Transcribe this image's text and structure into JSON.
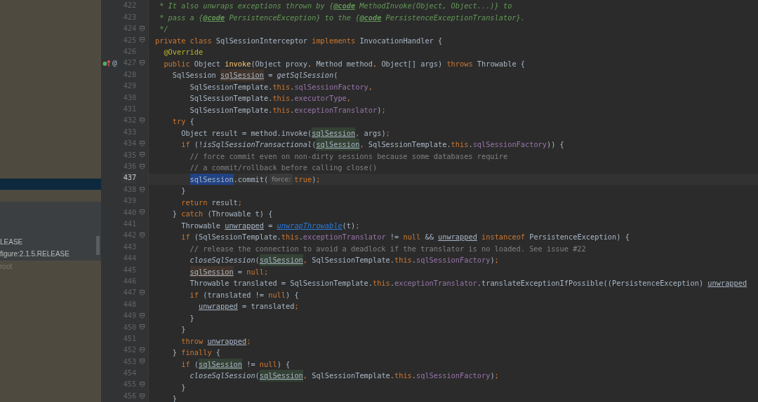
{
  "sidebar": {
    "rows": [
      {
        "selected": true
      }
    ],
    "popup_lines": [
      "LEASE",
      "figure:2.1.5.RELEASE"
    ],
    "dimmed_item": {
      "text": "root",
      "disabled": true
    }
  },
  "editor": {
    "lines": [
      {
        "number": "422",
        "fold": false,
        "current": false,
        "tokens": [
          {
            "kind": "doc",
            "text": " * It also unwraps exceptions thrown by {"
          },
          {
            "kind": "doc-tag",
            "text": "@code"
          },
          {
            "kind": "doc",
            "text": " MethodInvoke(Object, Object...)} to"
          }
        ]
      },
      {
        "number": "423",
        "fold": false,
        "current": false,
        "tokens": [
          {
            "kind": "doc",
            "text": " * pass a {"
          },
          {
            "kind": "doc-tag",
            "text": "@code"
          },
          {
            "kind": "doc",
            "text": " PersistenceException} to the {"
          },
          {
            "kind": "doc-tag",
            "text": "@code"
          },
          {
            "kind": "doc",
            "text": " PersistenceExceptionTranslator}."
          }
        ]
      },
      {
        "number": "424",
        "fold": true,
        "current": false,
        "tokens": [
          {
            "kind": "doc",
            "text": " */"
          }
        ]
      },
      {
        "number": "425",
        "fold": true,
        "current": false,
        "tokens": [
          {
            "kind": "keyword",
            "text": "private class "
          },
          {
            "kind": "plain",
            "text": "SqlSessionInterceptor "
          },
          {
            "kind": "keyword",
            "text": "implements "
          },
          {
            "kind": "plain",
            "text": "InvocationHandler {"
          }
        ],
        "children": [
          {
            "number": "426",
            "fold": false,
            "current": false,
            "tokens": [
              {
                "kind": "annotation",
                "text": "@Override"
              }
            ]
          },
          {
            "number": "427",
            "fold": true,
            "current": false,
            "gutter": [
              {
                "kind": "override-icon"
              },
              {
                "kind": "char",
                "text": "@"
              }
            ],
            "tokens": [
              {
                "kind": "keyword",
                "text": "public "
              },
              {
                "kind": "plain",
                "text": "Object "
              },
              {
                "kind": "method-decl",
                "text": "invoke"
              },
              {
                "kind": "plain",
                "text": "(Object proxy"
              },
              {
                "kind": "punct",
                "text": ", "
              },
              {
                "kind": "plain",
                "text": "Method method"
              },
              {
                "kind": "punct",
                "text": ", "
              },
              {
                "kind": "plain",
                "text": "Object[] args) "
              },
              {
                "kind": "keyword",
                "text": "throws "
              },
              {
                "kind": "plain",
                "text": "Throwable {"
              }
            ],
            "children": [
              {
                "number": "428",
                "fold": false,
                "current": false,
                "tokens": [
                  {
                    "kind": "plain",
                    "text": "SqlSession "
                  },
                  {
                    "kind": "write",
                    "text": "sqlSession"
                  },
                  {
                    "kind": "plain",
                    "text": " = "
                  },
                  {
                    "kind": "static",
                    "text": "getSqlSession"
                  },
                  {
                    "kind": "plain",
                    "text": "("
                  }
                ],
                "children": [
                  {
                    "number": "429",
                    "fold": false,
                    "current": false,
                    "continuation": true,
                    "tokens": [
                      {
                        "kind": "plain",
                        "text": "SqlSessionTemplate."
                      },
                      {
                        "kind": "keyword",
                        "text": "this"
                      },
                      {
                        "kind": "plain",
                        "text": "."
                      },
                      {
                        "kind": "field",
                        "text": "sqlSessionFactory"
                      },
                      {
                        "kind": "punct",
                        "text": ","
                      }
                    ]
                  },
                  {
                    "number": "430",
                    "fold": false,
                    "current": false,
                    "continuation": true,
                    "tokens": [
                      {
                        "kind": "plain",
                        "text": "SqlSessionTemplate."
                      },
                      {
                        "kind": "keyword",
                        "text": "this"
                      },
                      {
                        "kind": "plain",
                        "text": "."
                      },
                      {
                        "kind": "field",
                        "text": "executorType"
                      },
                      {
                        "kind": "punct",
                        "text": ","
                      }
                    ]
                  },
                  {
                    "number": "431",
                    "fold": false,
                    "current": false,
                    "continuation": true,
                    "tokens": [
                      {
                        "kind": "plain",
                        "text": "SqlSessionTemplate."
                      },
                      {
                        "kind": "keyword",
                        "text": "this"
                      },
                      {
                        "kind": "plain",
                        "text": "."
                      },
                      {
                        "kind": "field",
                        "text": "exceptionTranslator"
                      },
                      {
                        "kind": "plain",
                        "text": ")"
                      },
                      {
                        "kind": "punct",
                        "text": ";"
                      }
                    ]
                  }
                ]
              },
              {
                "number": "432",
                "fold": true,
                "current": false,
                "tokens": [
                  {
                    "kind": "keyword",
                    "text": "try "
                  },
                  {
                    "kind": "plain",
                    "text": "{"
                  }
                ],
                "children": [
                  {
                    "number": "433",
                    "fold": false,
                    "current": false,
                    "tokens": [
                      {
                        "kind": "plain",
                        "text": "Object result = method.invoke("
                      },
                      {
                        "kind": "read",
                        "text": "sqlSession"
                      },
                      {
                        "kind": "punct",
                        "text": ", "
                      },
                      {
                        "kind": "plain",
                        "text": "args)"
                      },
                      {
                        "kind": "punct",
                        "text": ";"
                      }
                    ]
                  },
                  {
                    "number": "434",
                    "fold": true,
                    "current": false,
                    "tokens": [
                      {
                        "kind": "keyword",
                        "text": "if "
                      },
                      {
                        "kind": "plain",
                        "text": "(!"
                      },
                      {
                        "kind": "static",
                        "text": "isSqlSessionTransactional"
                      },
                      {
                        "kind": "plain",
                        "text": "("
                      },
                      {
                        "kind": "read",
                        "text": "sqlSession"
                      },
                      {
                        "kind": "punct",
                        "text": ", "
                      },
                      {
                        "kind": "plain",
                        "text": "SqlSessionTemplate."
                      },
                      {
                        "kind": "keyword",
                        "text": "this"
                      },
                      {
                        "kind": "plain",
                        "text": "."
                      },
                      {
                        "kind": "field",
                        "text": "sqlSessionFactory"
                      },
                      {
                        "kind": "plain",
                        "text": ")) {"
                      }
                    ],
                    "children": [
                      {
                        "number": "435",
                        "fold": true,
                        "current": false,
                        "tokens": [
                          {
                            "kind": "comment",
                            "text": "// force commit even on non-dirty sessions because some databases require"
                          }
                        ]
                      },
                      {
                        "number": "436",
                        "fold": true,
                        "current": false,
                        "tokens": [
                          {
                            "kind": "comment",
                            "text": "// a commit/rollback before calling close()"
                          }
                        ]
                      },
                      {
                        "number": "437",
                        "fold": false,
                        "current": true,
                        "tokens": [
                          {
                            "kind": "selected",
                            "text": "sqlSession"
                          },
                          {
                            "kind": "plain",
                            "text": ".commit("
                          },
                          {
                            "kind": "hint",
                            "text": "force:"
                          },
                          {
                            "kind": "keyword",
                            "text": "true"
                          },
                          {
                            "kind": "plain",
                            "text": ")"
                          },
                          {
                            "kind": "punct",
                            "text": ";"
                          }
                        ]
                      }
                    ]
                  },
                  {
                    "number": "438",
                    "fold": true,
                    "current": false,
                    "tokens": [
                      {
                        "kind": "plain",
                        "text": "}"
                      }
                    ]
                  },
                  {
                    "number": "439",
                    "fold": false,
                    "current": false,
                    "tokens": [
                      {
                        "kind": "keyword",
                        "text": "return "
                      },
                      {
                        "kind": "plain",
                        "text": "result"
                      },
                      {
                        "kind": "punct",
                        "text": ";"
                      }
                    ]
                  }
                ]
              },
              {
                "number": "440",
                "fold": true,
                "current": false,
                "tokens": [
                  {
                    "kind": "plain",
                    "text": "} "
                  },
                  {
                    "kind": "keyword",
                    "text": "catch "
                  },
                  {
                    "kind": "plain",
                    "text": "(Throwable t) {"
                  }
                ],
                "children": [
                  {
                    "number": "441",
                    "fold": false,
                    "current": false,
                    "tokens": [
                      {
                        "kind": "plain",
                        "text": "Throwable "
                      },
                      {
                        "kind": "var",
                        "text": "unwrapped"
                      },
                      {
                        "kind": "plain",
                        "text": " = "
                      },
                      {
                        "kind": "link",
                        "text": "unwrapThrowable"
                      },
                      {
                        "kind": "plain",
                        "text": "(t)"
                      },
                      {
                        "kind": "punct",
                        "text": ";"
                      }
                    ]
                  },
                  {
                    "number": "442",
                    "fold": true,
                    "current": false,
                    "tokens": [
                      {
                        "kind": "keyword",
                        "text": "if "
                      },
                      {
                        "kind": "plain",
                        "text": "(SqlSessionTemplate."
                      },
                      {
                        "kind": "keyword",
                        "text": "this"
                      },
                      {
                        "kind": "plain",
                        "text": "."
                      },
                      {
                        "kind": "field",
                        "text": "exceptionTranslator"
                      },
                      {
                        "kind": "plain",
                        "text": " != "
                      },
                      {
                        "kind": "keyword",
                        "text": "null "
                      },
                      {
                        "kind": "plain",
                        "text": "&& "
                      },
                      {
                        "kind": "var",
                        "text": "unwrapped"
                      },
                      {
                        "kind": "keyword",
                        "text": " instanceof "
                      },
                      {
                        "kind": "plain",
                        "text": "PersistenceException) {"
                      }
                    ],
                    "children": [
                      {
                        "number": "443",
                        "fold": false,
                        "current": false,
                        "tokens": [
                          {
                            "kind": "comment",
                            "text": "// release the connection to avoid a deadlock if the translator is no loaded. See issue #22"
                          }
                        ]
                      },
                      {
                        "number": "444",
                        "fold": false,
                        "current": false,
                        "tokens": [
                          {
                            "kind": "static",
                            "text": "closeSqlSession"
                          },
                          {
                            "kind": "plain",
                            "text": "("
                          },
                          {
                            "kind": "read",
                            "text": "sqlSession"
                          },
                          {
                            "kind": "punct",
                            "text": ", "
                          },
                          {
                            "kind": "plain",
                            "text": "SqlSessionTemplate."
                          },
                          {
                            "kind": "keyword",
                            "text": "this"
                          },
                          {
                            "kind": "plain",
                            "text": "."
                          },
                          {
                            "kind": "field",
                            "text": "sqlSessionFactory"
                          },
                          {
                            "kind": "plain",
                            "text": ")"
                          },
                          {
                            "kind": "punct",
                            "text": ";"
                          }
                        ]
                      },
                      {
                        "number": "445",
                        "fold": false,
                        "current": false,
                        "tokens": [
                          {
                            "kind": "write",
                            "text": "sqlSession"
                          },
                          {
                            "kind": "plain",
                            "text": " = "
                          },
                          {
                            "kind": "keyword",
                            "text": "null"
                          },
                          {
                            "kind": "punct",
                            "text": ";"
                          }
                        ]
                      },
                      {
                        "number": "446",
                        "fold": false,
                        "current": false,
                        "tokens": [
                          {
                            "kind": "plain",
                            "text": "Throwable translated = SqlSessionTemplate."
                          },
                          {
                            "kind": "keyword",
                            "text": "this"
                          },
                          {
                            "kind": "plain",
                            "text": "."
                          },
                          {
                            "kind": "field",
                            "text": "exceptionTranslator"
                          },
                          {
                            "kind": "plain",
                            "text": ".translateExceptionIfPossible((PersistenceException) "
                          },
                          {
                            "kind": "var",
                            "text": "unwrapped"
                          }
                        ]
                      },
                      {
                        "number": "447",
                        "fold": true,
                        "current": false,
                        "tokens": [
                          {
                            "kind": "keyword",
                            "text": "if "
                          },
                          {
                            "kind": "plain",
                            "text": "(translated != "
                          },
                          {
                            "kind": "keyword",
                            "text": "null"
                          },
                          {
                            "kind": "plain",
                            "text": ") {"
                          }
                        ],
                        "children": [
                          {
                            "number": "448",
                            "fold": false,
                            "current": false,
                            "tokens": [
                              {
                                "kind": "var",
                                "text": "unwrapped"
                              },
                              {
                                "kind": "plain",
                                "text": " = translated"
                              },
                              {
                                "kind": "punct",
                                "text": ";"
                              }
                            ]
                          }
                        ]
                      },
                      {
                        "number": "449",
                        "fold": true,
                        "current": false,
                        "tokens": [
                          {
                            "kind": "plain",
                            "text": "}"
                          }
                        ]
                      }
                    ]
                  },
                  {
                    "number": "450",
                    "fold": true,
                    "current": false,
                    "tokens": [
                      {
                        "kind": "plain",
                        "text": "}"
                      }
                    ]
                  },
                  {
                    "number": "451",
                    "fold": false,
                    "current": false,
                    "tokens": [
                      {
                        "kind": "keyword",
                        "text": "throw "
                      },
                      {
                        "kind": "var",
                        "text": "unwrapped"
                      },
                      {
                        "kind": "punct",
                        "text": ";"
                      }
                    ]
                  }
                ]
              },
              {
                "number": "452",
                "fold": true,
                "current": false,
                "tokens": [
                  {
                    "kind": "plain",
                    "text": "} "
                  },
                  {
                    "kind": "keyword",
                    "text": "finally "
                  },
                  {
                    "kind": "plain",
                    "text": "{"
                  }
                ],
                "children": [
                  {
                    "number": "453",
                    "fold": true,
                    "current": false,
                    "tokens": [
                      {
                        "kind": "keyword",
                        "text": "if "
                      },
                      {
                        "kind": "plain",
                        "text": "("
                      },
                      {
                        "kind": "read",
                        "text": "sqlSession"
                      },
                      {
                        "kind": "plain",
                        "text": " != "
                      },
                      {
                        "kind": "keyword",
                        "text": "null"
                      },
                      {
                        "kind": "plain",
                        "text": ") {"
                      }
                    ],
                    "children": [
                      {
                        "number": "454",
                        "fold": false,
                        "current": false,
                        "tokens": [
                          {
                            "kind": "static",
                            "text": "closeSqlSession"
                          },
                          {
                            "kind": "plain",
                            "text": "("
                          },
                          {
                            "kind": "read",
                            "text": "sqlSession"
                          },
                          {
                            "kind": "punct",
                            "text": ", "
                          },
                          {
                            "kind": "plain",
                            "text": "SqlSessionTemplate."
                          },
                          {
                            "kind": "keyword",
                            "text": "this"
                          },
                          {
                            "kind": "plain",
                            "text": "."
                          },
                          {
                            "kind": "field",
                            "text": "sqlSessionFactory"
                          },
                          {
                            "kind": "plain",
                            "text": ")"
                          },
                          {
                            "kind": "punct",
                            "text": ";"
                          }
                        ]
                      }
                    ]
                  },
                  {
                    "number": "455",
                    "fold": true,
                    "current": false,
                    "tokens": [
                      {
                        "kind": "plain",
                        "text": "}"
                      }
                    ]
                  }
                ]
              },
              {
                "number": "456",
                "fold": true,
                "current": false,
                "tokens": [
                  {
                    "kind": "plain",
                    "text": "}"
                  }
                ]
              }
            ]
          }
        ]
      }
    ]
  }
}
